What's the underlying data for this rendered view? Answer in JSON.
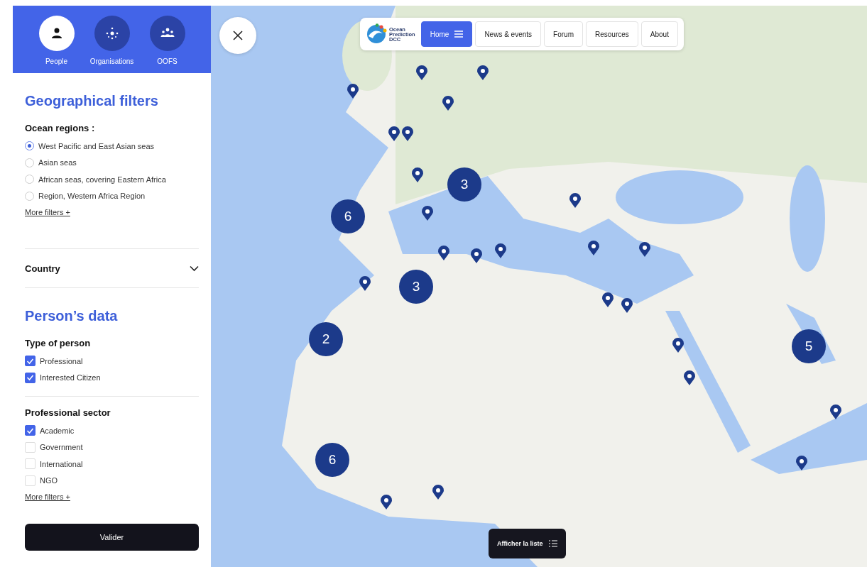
{
  "tabs": [
    {
      "label": "People",
      "selected": true
    },
    {
      "label": "Organisations",
      "selected": false
    },
    {
      "label": "OOFS",
      "selected": false
    }
  ],
  "geographical_filters": {
    "title": "Geographical filters",
    "group_label": "Ocean regions :",
    "regions": [
      {
        "label": "West Pacific and East Asian seas",
        "selected": true
      },
      {
        "label": "Asian seas",
        "selected": false
      },
      {
        "label": "African seas, covering Eastern Africa",
        "selected": false
      },
      {
        "label": "Region, Western Africa Region",
        "selected": false
      }
    ],
    "more": "More filters +"
  },
  "country": {
    "label": "Country",
    "expanded": false
  },
  "persons_data": {
    "title": "Person’s data",
    "groups": [
      {
        "title": "Type of person",
        "options": [
          {
            "label": "Professional",
            "checked": true
          },
          {
            "label": "Interested Citizen",
            "checked": true
          }
        ]
      },
      {
        "title": "Professional sector",
        "options": [
          {
            "label": "Academic",
            "checked": true
          },
          {
            "label": "Government",
            "checked": false
          },
          {
            "label": "International",
            "checked": false
          },
          {
            "label": "NGO",
            "checked": false
          }
        ],
        "more": "More filters +"
      }
    ]
  },
  "submit": "Valider",
  "nav": {
    "logo_lines": [
      "Ocean",
      "Prediction",
      "DCC"
    ],
    "items": [
      {
        "label": "Home",
        "selected": true
      },
      {
        "label": "News & events",
        "selected": false
      },
      {
        "label": "Forum",
        "selected": false
      },
      {
        "label": "Resources",
        "selected": false
      },
      {
        "label": "About",
        "selected": false
      }
    ]
  },
  "map": {
    "clusters": [
      {
        "count": "3"
      },
      {
        "count": "6"
      },
      {
        "count": "3"
      },
      {
        "count": "2"
      },
      {
        "count": "5"
      },
      {
        "count": "6"
      }
    ],
    "list_button": "Afficher la liste"
  }
}
